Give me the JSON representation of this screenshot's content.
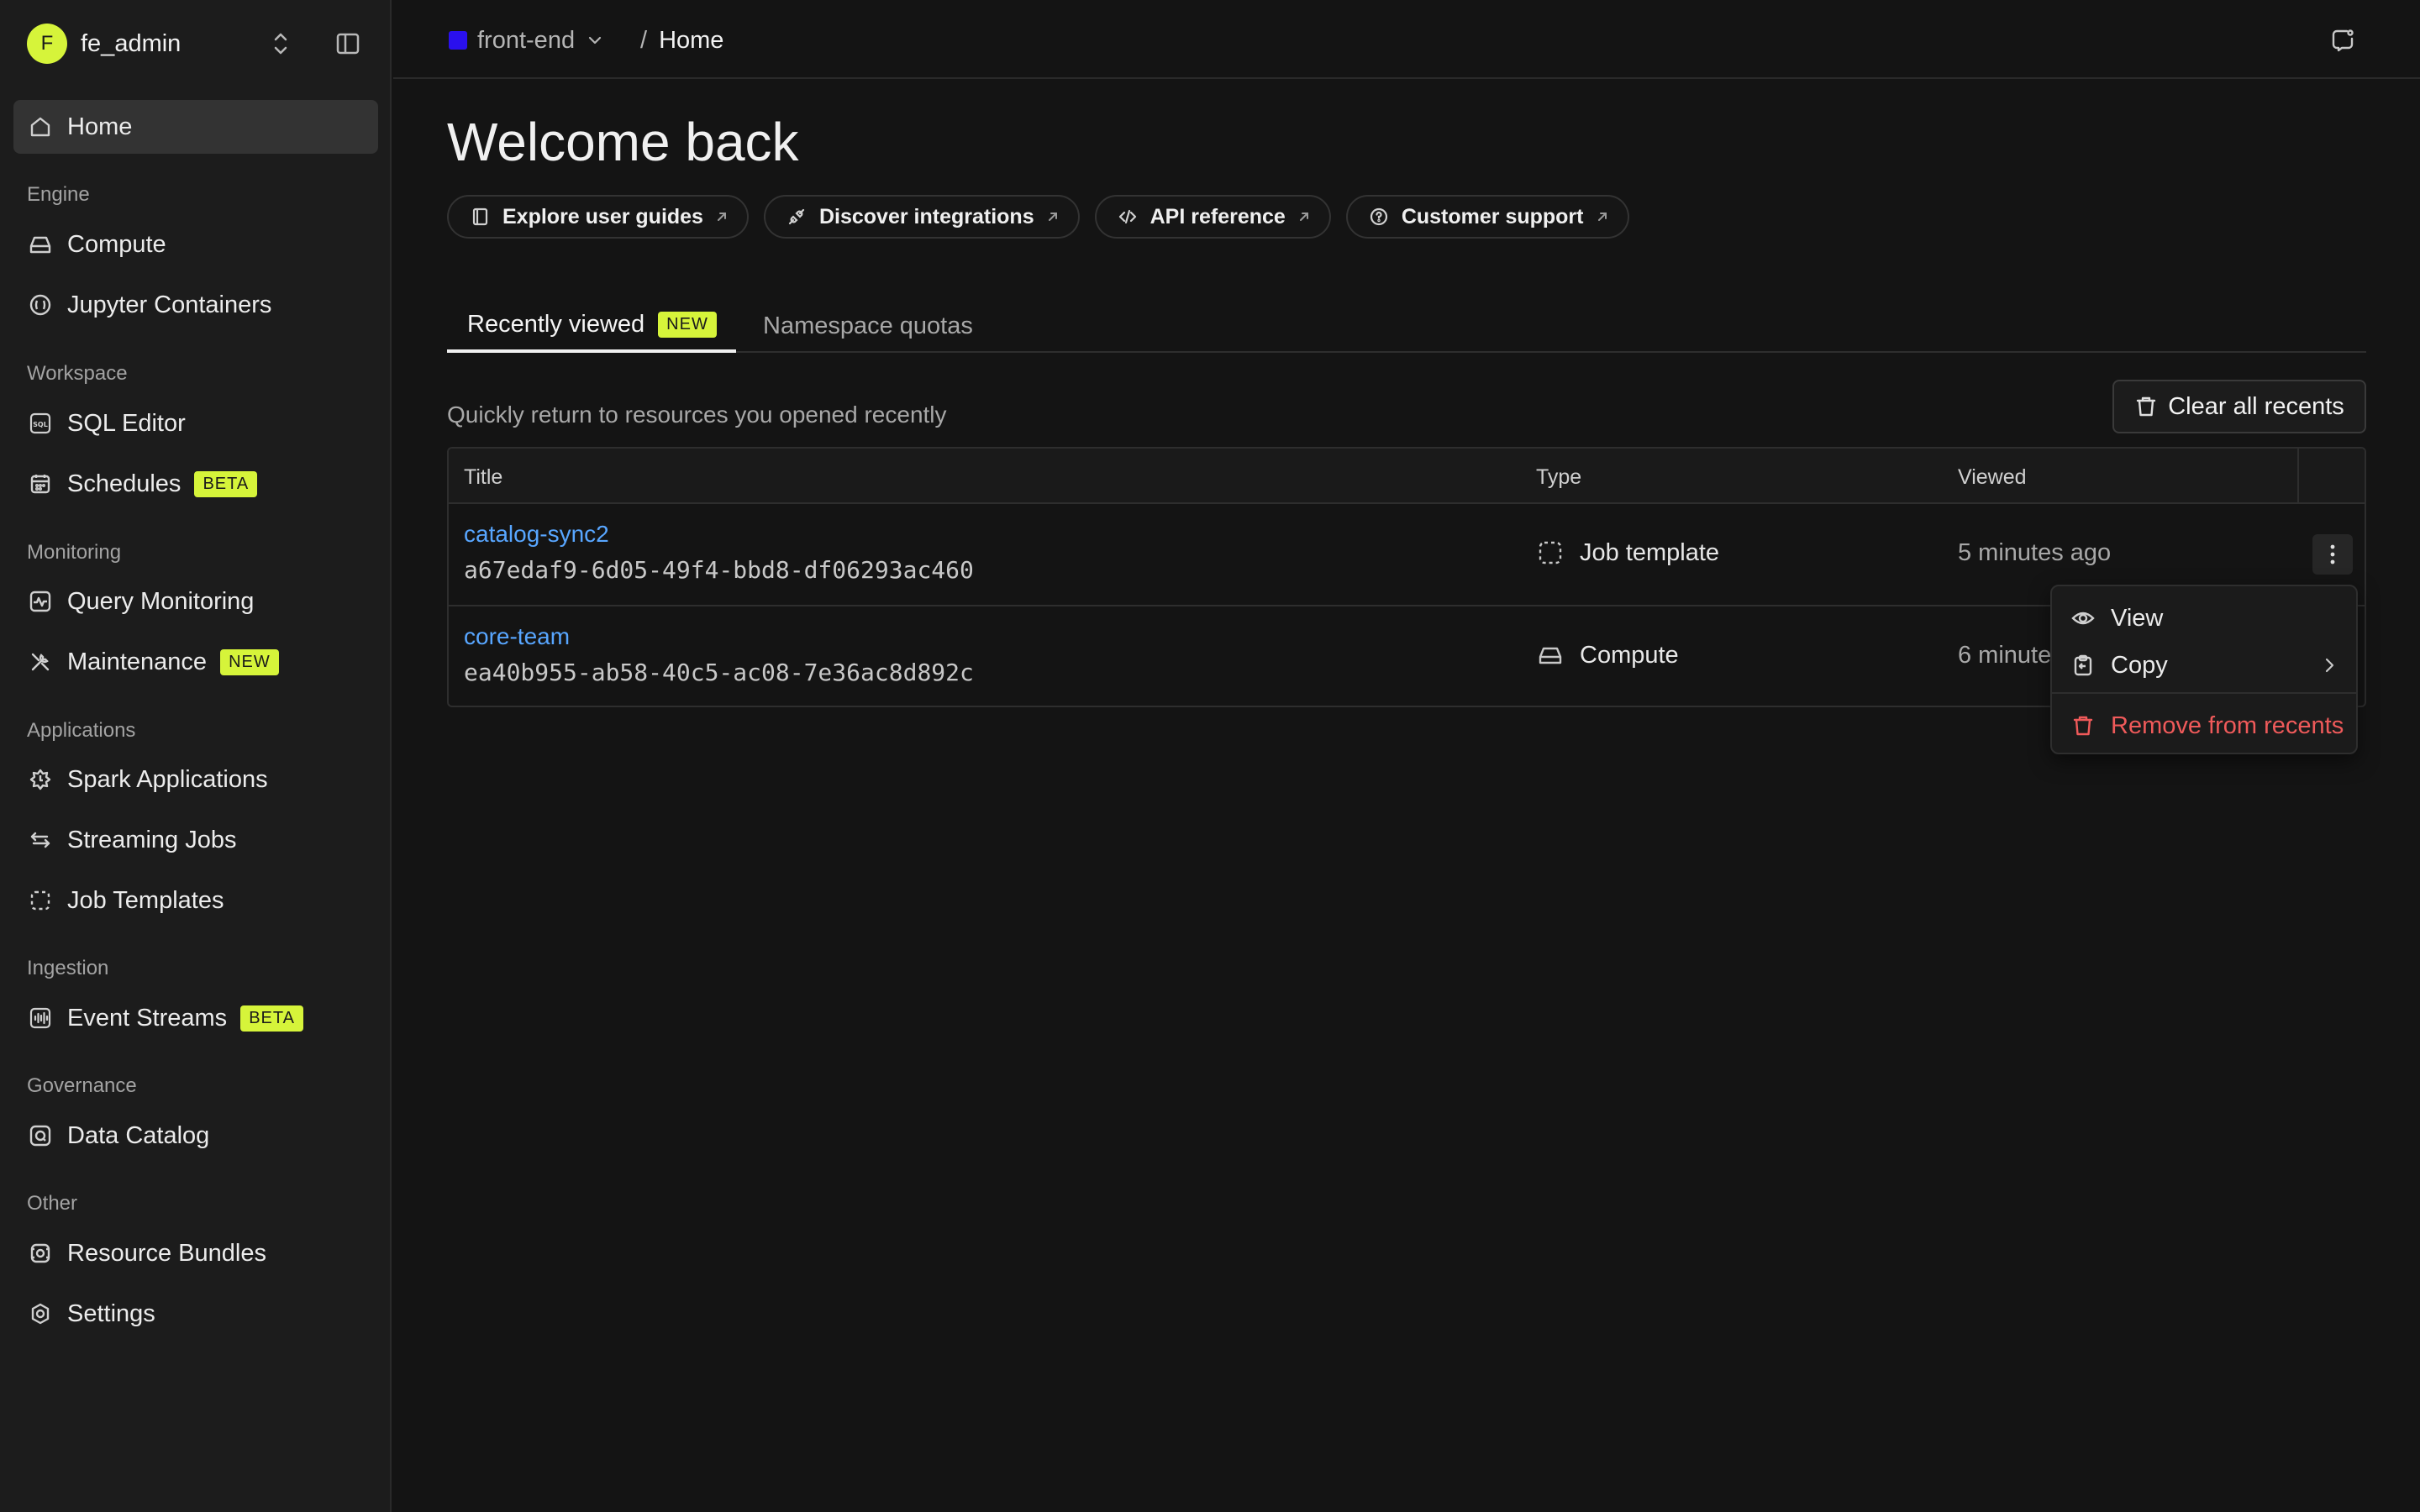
{
  "colors": {
    "accent": "#d6f43a",
    "link": "#58a6ff",
    "danger": "#ef5a5a",
    "namespace": "#2a10ee",
    "background": "#141414",
    "sidebar": "#1c1c1c"
  },
  "sidebar": {
    "account": {
      "initial": "F",
      "name": "fe_admin"
    },
    "home": {
      "label": "Home",
      "icon": "home-icon"
    },
    "sections": [
      {
        "label": "Engine",
        "items": [
          {
            "label": "Compute",
            "icon": "hard-drive-icon"
          },
          {
            "label": "Jupyter Containers",
            "icon": "jupyter-icon"
          }
        ]
      },
      {
        "label": "Workspace",
        "items": [
          {
            "label": "SQL Editor",
            "icon": "sql-icon"
          },
          {
            "label": "Schedules",
            "icon": "calendar-icon",
            "badge": "BETA"
          }
        ]
      },
      {
        "label": "Monitoring",
        "items": [
          {
            "label": "Query Monitoring",
            "icon": "activity-icon"
          },
          {
            "label": "Maintenance",
            "icon": "tools-icon",
            "badge": "NEW"
          }
        ]
      },
      {
        "label": "Applications",
        "items": [
          {
            "label": "Spark Applications",
            "icon": "spark-icon"
          },
          {
            "label": "Streaming Jobs",
            "icon": "arrows-icon"
          },
          {
            "label": "Job Templates",
            "icon": "dashed-square-icon"
          }
        ]
      },
      {
        "label": "Ingestion",
        "items": [
          {
            "label": "Event Streams",
            "icon": "audio-wave-icon",
            "badge": "BETA"
          }
        ]
      },
      {
        "label": "Governance",
        "items": [
          {
            "label": "Data Catalog",
            "icon": "catalog-icon"
          }
        ]
      },
      {
        "label": "Other",
        "items": [
          {
            "label": "Resource Bundles",
            "icon": "bundle-icon"
          },
          {
            "label": "Settings",
            "icon": "settings-icon"
          }
        ]
      }
    ]
  },
  "topbar": {
    "namespace": "front-end",
    "separator": "/",
    "current": "Home"
  },
  "main": {
    "title": "Welcome back",
    "quick_links": [
      {
        "label": "Explore user guides",
        "icon": "book-icon"
      },
      {
        "label": "Discover integrations",
        "icon": "plug-icon"
      },
      {
        "label": "API reference",
        "icon": "code-icon"
      },
      {
        "label": "Customer support",
        "icon": "help-circle-icon"
      }
    ],
    "tabs": [
      {
        "label": "Recently viewed",
        "badge": "NEW",
        "active": true
      },
      {
        "label": "Namespace quotas",
        "active": false
      }
    ],
    "subtitle": "Quickly return to resources you opened recently",
    "clear_button": "Clear all recents"
  },
  "table": {
    "headers": {
      "title": "Title",
      "type": "Type",
      "viewed": "Viewed"
    },
    "rows": [
      {
        "title": "catalog-sync2",
        "id": "a67edaf9-6d05-49f4-bbd8-df06293ac460",
        "type": "Job template",
        "type_icon": "dashed-square-icon",
        "viewed": "5 minutes ago"
      },
      {
        "title": "core-team",
        "id": "ea40b955-ab58-40c5-ac08-7e36ac8d892c",
        "type": "Compute",
        "type_icon": "hard-drive-icon",
        "viewed": "6 minutes ago"
      }
    ]
  },
  "context_menu": {
    "items": [
      {
        "label": "View",
        "icon": "eye-icon"
      },
      {
        "label": "Copy",
        "icon": "clipboard-icon",
        "submenu": true
      },
      {
        "label": "Remove from recents",
        "icon": "trash-icon",
        "danger": true
      }
    ]
  }
}
